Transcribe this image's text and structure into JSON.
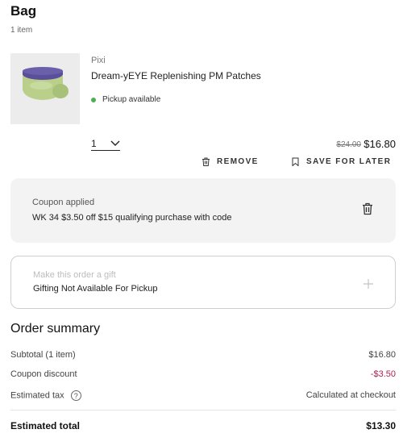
{
  "bag": {
    "title": "Bag",
    "item_count": "1 item"
  },
  "item": {
    "brand": "Pixi",
    "name": "Dream-yEYE Replenishing PM Patches",
    "pickup_status": "Pickup available",
    "quantity": "1",
    "original_price": "$24.00",
    "sale_price": "$16.80",
    "remove_label": "REMOVE",
    "save_label": "SAVE FOR LATER",
    "image_icon": "product-jar-image"
  },
  "coupon": {
    "label": "Coupon applied",
    "text": "WK 34 $3.50 off $15 qualifying purchase with code"
  },
  "gift": {
    "label": "Make this order a gift",
    "text": "Gifting Not Available For Pickup"
  },
  "summary": {
    "title": "Order summary",
    "subtotal_label": "Subtotal (1 item)",
    "subtotal_value": "$16.80",
    "coupon_label": "Coupon discount",
    "coupon_value": "-$3.50",
    "tax_label": "Estimated tax",
    "tax_help": "?",
    "tax_value": "Calculated at checkout",
    "total_label": "Estimated total",
    "total_value": "$13.30"
  },
  "colors": {
    "pickup_dot": "#4caf50",
    "discount": "#b01f55",
    "coupon_bg": "#f3f3f3",
    "jar_body": "#b9cf8a",
    "jar_lid": "#5a4f9a"
  }
}
